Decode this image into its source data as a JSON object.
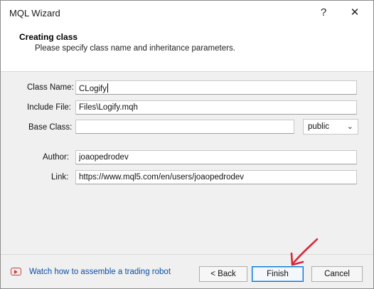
{
  "window": {
    "title": "MQL Wizard",
    "help_glyph": "?",
    "close_glyph": "✕"
  },
  "header": {
    "title": "Creating class",
    "subtitle": "Please specify class name and inheritance parameters."
  },
  "form": {
    "class_name": {
      "label": "Class Name:",
      "value": "CLogify"
    },
    "include_file": {
      "label": "Include File:",
      "value": "Files\\Logify.mqh"
    },
    "base_class": {
      "label": "Base Class:",
      "value": "",
      "access": "public"
    },
    "author": {
      "label": "Author:",
      "value": "joaopedrodev"
    },
    "link": {
      "label": "Link:",
      "value": "https://www.mql5.com/en/users/joaopedrodev"
    }
  },
  "footer": {
    "video_link": "Watch how to assemble a trading robot",
    "back_label": "< Back",
    "finish_label": "Finish",
    "cancel_label": "Cancel"
  },
  "colors": {
    "accent": "#0078d7",
    "link": "#0b4ea6",
    "annotation": "#d9283a",
    "video_icon": "#d23b3b"
  },
  "icons": {
    "chevron": "chevron-down-icon",
    "video": "video-play-icon",
    "annotation": "red-arrow-annotation"
  }
}
